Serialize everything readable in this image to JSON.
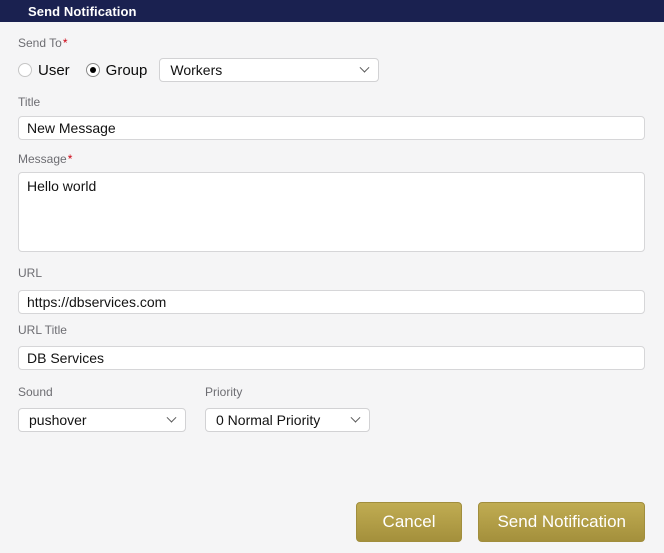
{
  "header": {
    "title": "Send Notification"
  },
  "form": {
    "required_marker": "*",
    "send_to": {
      "label": "Send To",
      "required": true,
      "options": [
        {
          "label": "User",
          "selected": false
        },
        {
          "label": "Group",
          "selected": true
        }
      ],
      "group_select": {
        "value": "Workers"
      }
    },
    "title": {
      "label": "Title",
      "value": "New Message"
    },
    "message": {
      "label": "Message",
      "required": true,
      "value": "Hello world"
    },
    "url": {
      "label": "URL",
      "value": "https://dbservices.com"
    },
    "url_title": {
      "label": "URL Title",
      "value": "DB Services"
    },
    "sound": {
      "label": "Sound",
      "value": "pushover"
    },
    "priority": {
      "label": "Priority",
      "value": "0 Normal Priority"
    }
  },
  "footer": {
    "cancel_label": "Cancel",
    "send_label": "Send Notification"
  },
  "icons": {
    "chevron_down": "css-chevron-v"
  },
  "colors": {
    "header_bg": "#1a2150",
    "page_bg": "#f5f5f6",
    "button_gold_top": "#c0ac52",
    "button_gold_bottom": "#a4903c",
    "required_asterisk": "#cc0011",
    "label_text": "#6d6d72"
  }
}
